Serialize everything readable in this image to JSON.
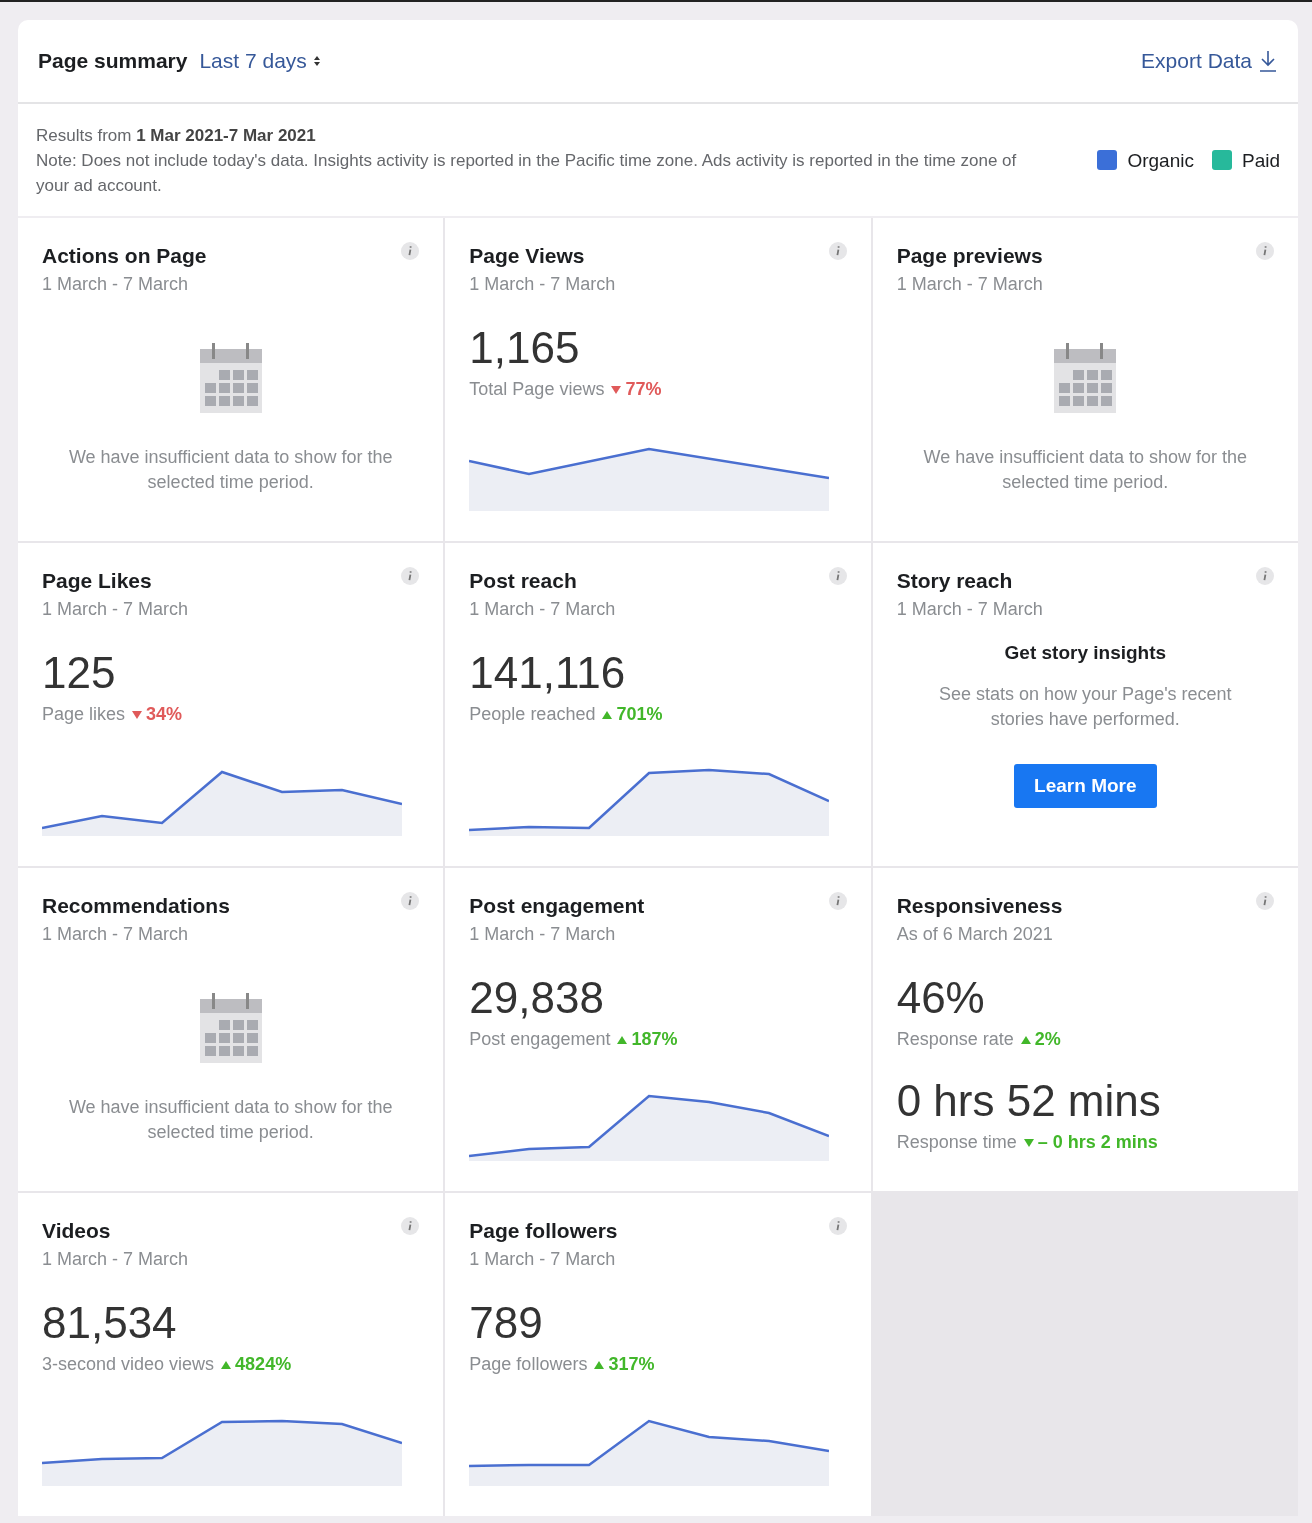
{
  "header": {
    "title": "Page summary",
    "range": "Last 7 days",
    "export": "Export Data"
  },
  "info": {
    "results": "Results from **1 Mar 2021-7 Mar 2021**",
    "note": "Note: Does not include today's data. Insights activity is reported in the Pacific time zone. Ads activity is reported in the time zone of your ad account.",
    "legend": [
      {
        "label": "Organic",
        "color": "#3b6fd8"
      },
      {
        "label": "Paid",
        "color": "#27b99b"
      }
    ]
  },
  "cards": [
    {
      "kind": "empty",
      "title": "Actions on Page",
      "period": "1 March - 7 March",
      "message": "We have insufficient data to show for the selected time period."
    },
    {
      "kind": "metric",
      "title": "Page Views",
      "period": "1 March - 7 March",
      "stats": [
        {
          "value": "1,165",
          "label": "Total Page views",
          "change": "77%",
          "decrease": true,
          "color": "#e05a5a"
        }
      ]
    },
    {
      "kind": "empty",
      "title": "Page previews",
      "period": "1 March - 7 March",
      "message": "We have insufficient data to show for the selected time period."
    },
    {
      "kind": "metric",
      "title": "Page Likes",
      "period": "1 March - 7 March",
      "stats": [
        {
          "value": "125",
          "label": "Page likes",
          "change": "34%",
          "decrease": true,
          "color": "#e05a5a"
        }
      ]
    },
    {
      "kind": "metric",
      "title": "Post reach",
      "period": "1 March - 7 March",
      "stats": [
        {
          "value": "141,116",
          "label": "People reached",
          "change": "701%",
          "decrease": false,
          "color": "#42b72a"
        }
      ]
    },
    {
      "kind": "promo",
      "title": "Story reach",
      "period": "1 March - 7 March",
      "heading": "Get story insights",
      "message": "See stats on how your Page's recent stories have performed.",
      "button": "Learn More"
    },
    {
      "kind": "empty",
      "title": "Recommendations",
      "period": "1 March - 7 March",
      "message": "We have insufficient data to show for the selected time period."
    },
    {
      "kind": "metric",
      "title": "Post engagement",
      "period": "1 March - 7 March",
      "stats": [
        {
          "value": "29,838",
          "label": "Post engagement",
          "change": "187%",
          "decrease": false,
          "color": "#42b72a"
        }
      ]
    },
    {
      "kind": "stats",
      "title": "Responsiveness",
      "period": "As of 6 March 2021",
      "stats": [
        {
          "value": "46%",
          "label": "Response rate",
          "change": "2%",
          "decrease": false,
          "color": "#42b72a"
        },
        {
          "value": "0 hrs 52 mins",
          "label": "Response time",
          "change": "– 0 hrs 2 mins",
          "decrease": true,
          "color": "#42b72a"
        }
      ]
    },
    {
      "kind": "metric",
      "title": "Videos",
      "period": "1 March - 7 March",
      "stats": [
        {
          "value": "81,534",
          "label": "3-second video views",
          "change": "4824%",
          "decrease": false,
          "color": "#42b72a"
        }
      ]
    },
    {
      "kind": "metric",
      "title": "Page followers",
      "period": "1 March - 7 March",
      "stats": [
        {
          "value": "789",
          "label": "Page followers",
          "change": "317%",
          "decrease": false,
          "color": "#42b72a"
        }
      ]
    }
  ]
}
